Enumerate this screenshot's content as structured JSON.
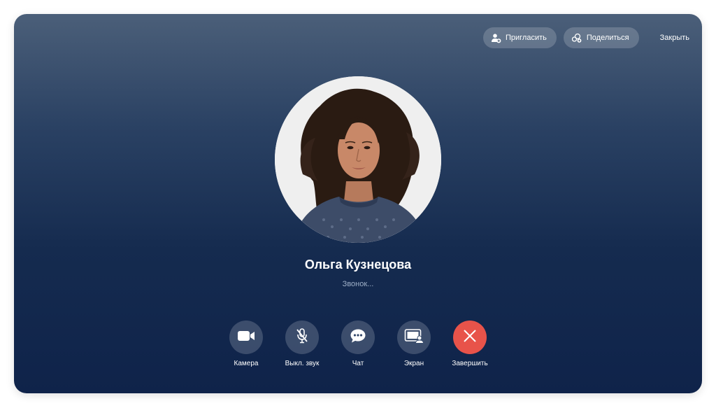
{
  "header": {
    "invite_label": "Пригласить",
    "share_label": "Поделиться",
    "close_label": "Закрыть"
  },
  "caller": {
    "name": "Ольга Кузнецова",
    "status": "Звонок...",
    "avatar": "woman-curly-hair-portrait"
  },
  "controls": [
    {
      "label": "Камера",
      "icon": "video-camera-icon"
    },
    {
      "label": "Выкл. звук",
      "icon": "microphone-off-icon"
    },
    {
      "label": "Чат",
      "icon": "chat-bubble-icon"
    },
    {
      "label": "Экран",
      "icon": "screen-share-icon"
    },
    {
      "label": "Завершить",
      "icon": "end-call-icon"
    }
  ],
  "colors": {
    "background_top": "#4b5f79",
    "background_bottom": "#0f234a",
    "end_call": "#e8534a",
    "control_bg": "rgba(255,255,255,0.18)"
  }
}
